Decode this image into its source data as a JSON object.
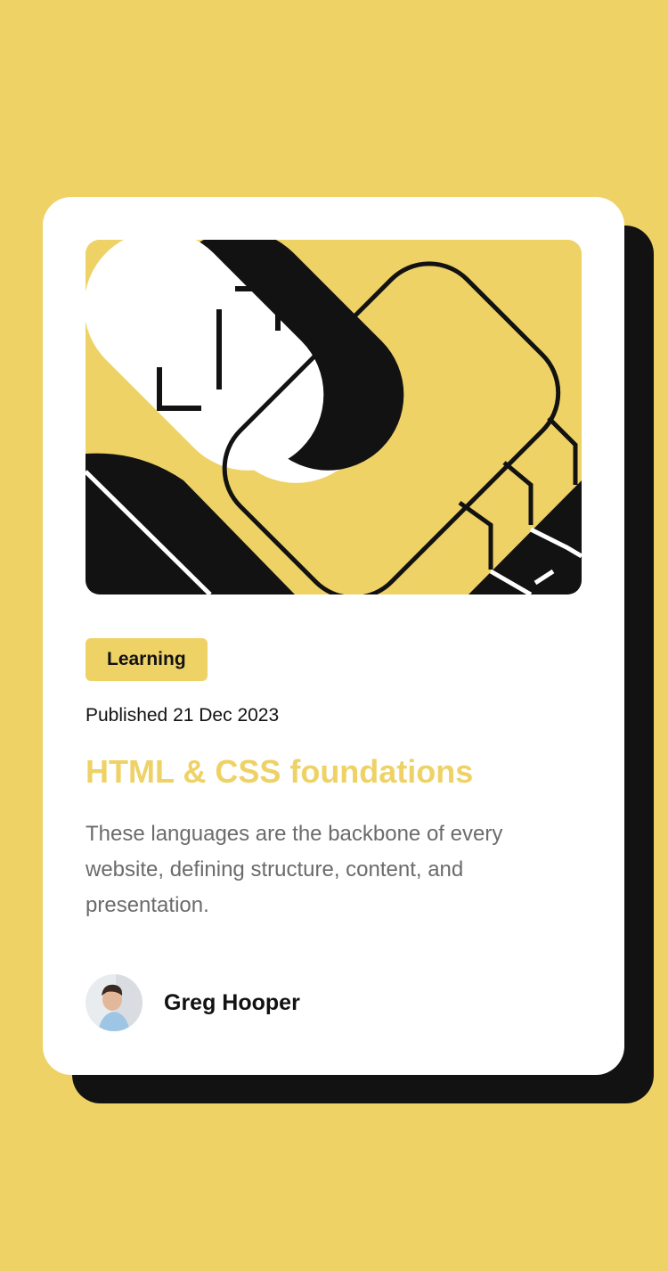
{
  "card": {
    "tag": "Learning",
    "published": "Published 21 Dec 2023",
    "title": "HTML & CSS foundations",
    "description": "These languages are the backbone of every website, defining structure, content, and presentation.",
    "author": "Greg Hooper"
  },
  "colors": {
    "background": "#EED266",
    "card": "#FFFFFF",
    "shadow": "#121212",
    "title": "#EED266",
    "text": "#121212",
    "muted": "#6B6B6B"
  },
  "icons": {
    "hero": "abstract-illustration",
    "avatar": "author-avatar"
  }
}
